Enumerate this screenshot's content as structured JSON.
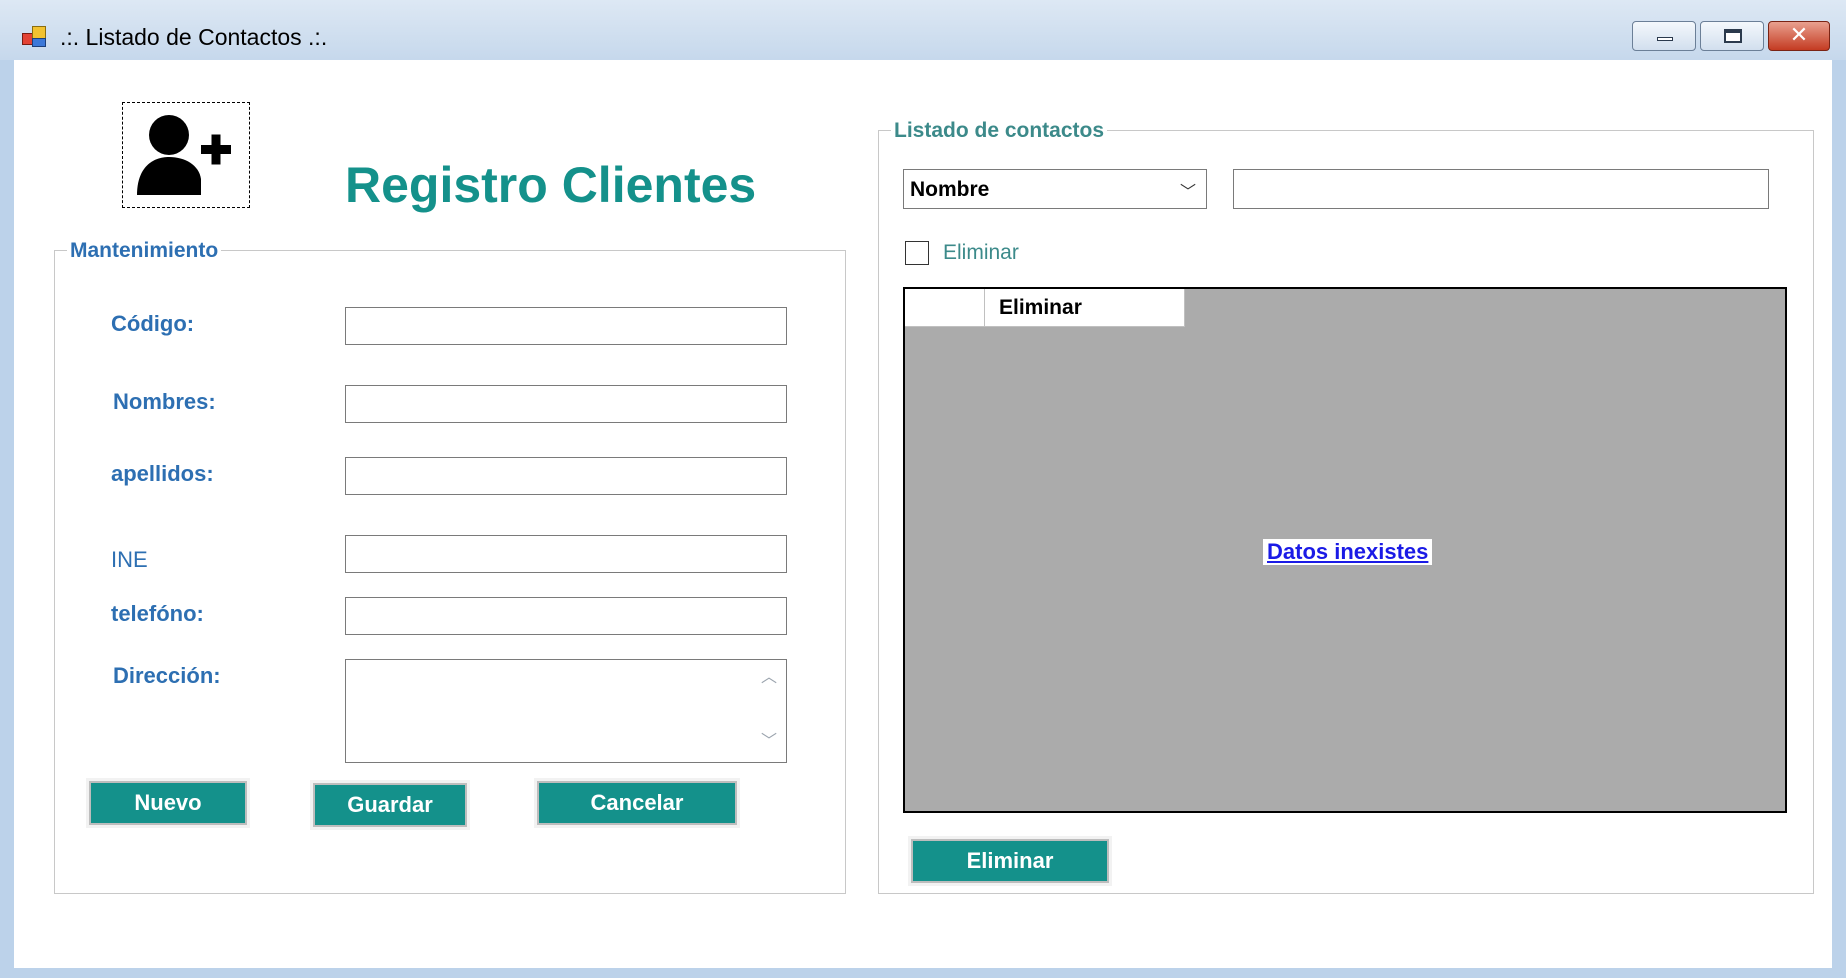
{
  "window": {
    "title": ".:. Listado de Contactos .:.",
    "controls": {
      "minimize_icon": "minimize-icon",
      "maximize_icon": "restore-icon",
      "close_icon": "close-icon",
      "close_glyph": "✕"
    }
  },
  "header": {
    "avatar_icon": "add-user-icon",
    "title": "Registro Clientes"
  },
  "maintenance": {
    "legend": "Mantenimiento",
    "fields": {
      "codigo": {
        "label": "Código:",
        "value": ""
      },
      "nombres": {
        "label": "Nombres:",
        "value": ""
      },
      "apellidos": {
        "label": "apellidos:",
        "value": ""
      },
      "ine": {
        "label": "INE",
        "value": ""
      },
      "telefono": {
        "label": "telefóno:",
        "value": ""
      },
      "direccion": {
        "label": "Dirección:",
        "value": ""
      }
    },
    "buttons": {
      "nuevo": "Nuevo",
      "guardar": "Guardar",
      "cancelar": "Cancelar"
    }
  },
  "contacts": {
    "legend": "Listado de contactos",
    "filter": {
      "selected": "Nombre",
      "search_value": ""
    },
    "delete_checkbox": {
      "label": "Eliminar",
      "checked": false
    },
    "grid": {
      "columns": [
        "",
        "Eliminar"
      ],
      "empty_message": "Datos inexistes"
    },
    "delete_button": "Eliminar"
  },
  "colors": {
    "accent": "#14918b",
    "label_blue": "#2d6fb2",
    "grid_bg": "#ababab",
    "link": "#1a1ae6"
  }
}
